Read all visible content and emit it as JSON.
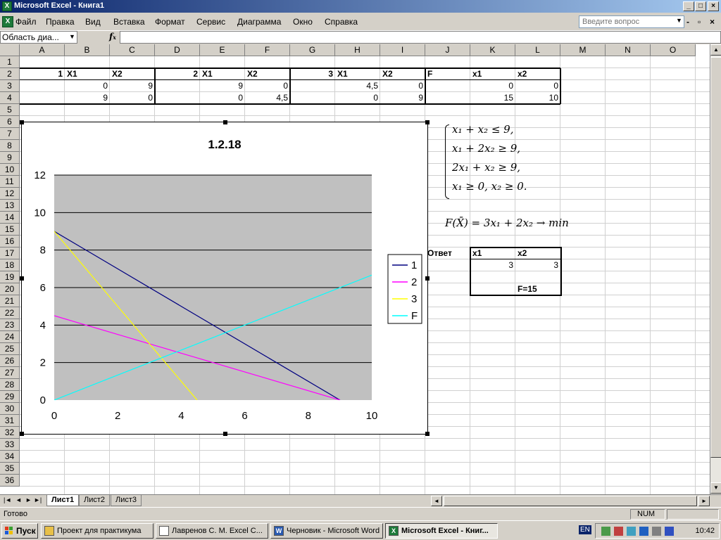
{
  "window": {
    "title": "Microsoft Excel - Книга1",
    "min": "_",
    "max": "□",
    "close": "×",
    "doc_min": "-",
    "doc_restore": "ⓧ",
    "doc_close": "×"
  },
  "menu": {
    "items": [
      "Файл",
      "Правка",
      "Вид",
      "Вставка",
      "Формат",
      "Сервис",
      "Диаграмма",
      "Окно",
      "Справка"
    ],
    "help_placeholder": "Введите вопрос"
  },
  "formula": {
    "namebox": "Область диа...",
    "fx": "fx"
  },
  "columns": [
    "A",
    "B",
    "C",
    "D",
    "E",
    "F",
    "G",
    "H",
    "I",
    "J",
    "K",
    "L",
    "M",
    "N",
    "O"
  ],
  "rows": [
    "1",
    "2",
    "3",
    "4",
    "5",
    "6",
    "7",
    "8",
    "9",
    "10",
    "11",
    "12",
    "13",
    "14",
    "15",
    "16",
    "17",
    "18",
    "19",
    "20",
    "21",
    "22",
    "23",
    "24",
    "25",
    "26",
    "27",
    "28",
    "29",
    "30",
    "31",
    "32",
    "33",
    "34",
    "35",
    "36"
  ],
  "cells": {
    "A2": "1",
    "B2": "X1",
    "C2": "X2",
    "D2": "2",
    "E2": "X1",
    "F2": "X2",
    "G2": "3",
    "H2": "X1",
    "I2": "X2",
    "J2": "F",
    "K2": "x1",
    "L2": "x2",
    "B3": "0",
    "C3": "9",
    "E3": "9",
    "F3": "0",
    "H3": "4,5",
    "I3": "0",
    "K3": "0",
    "L3": "0",
    "B4": "9",
    "C4": "0",
    "E4": "0",
    "F4": "4,5",
    "H4": "0",
    "I4": "9",
    "K4": "15",
    "L4": "10"
  },
  "answer": {
    "label": "Ответ",
    "h1": "x1",
    "h2": "x2",
    "v1": "3",
    "v2": "3",
    "f": "F=15"
  },
  "math": {
    "line1": "x₁ + x₂ ≤ 9,",
    "line2": "x₁ + 2x₂ ≥ 9,",
    "line3": "2x₁ + x₂ ≥ 9,",
    "line4": "x₁ ≥ 0, x₂ ≥ 0.",
    "objective": "F(X̄) = 3x₁ + 2x₂ → min"
  },
  "chart_data": {
    "type": "line",
    "title": "1.2.18",
    "xlim": [
      0,
      10
    ],
    "ylim": [
      0,
      12
    ],
    "x_ticks": [
      "0",
      "2",
      "4",
      "6",
      "8",
      "10"
    ],
    "y_ticks": [
      "0",
      "2",
      "4",
      "6",
      "8",
      "10",
      "12"
    ],
    "plot_bg": "#c0c0c0",
    "grid": true,
    "legend_position": "right",
    "series": [
      {
        "name": "1",
        "color": "#000080",
        "points": [
          [
            0,
            9
          ],
          [
            9,
            0
          ]
        ]
      },
      {
        "name": "2",
        "color": "#ff00ff",
        "points": [
          [
            0,
            4.5
          ],
          [
            9,
            0
          ]
        ]
      },
      {
        "name": "3",
        "color": "#ffff00",
        "points": [
          [
            0,
            9
          ],
          [
            4.5,
            0
          ]
        ]
      },
      {
        "name": "F",
        "color": "#00ffff",
        "points": [
          [
            0,
            0
          ],
          [
            15,
            10
          ]
        ]
      }
    ]
  },
  "sheets": {
    "tabs": [
      "Лист1",
      "Лист2",
      "Лист3"
    ],
    "active": 0
  },
  "status": {
    "ready": "Готово",
    "num": "NUM"
  },
  "taskbar": {
    "start": "Пуск",
    "buttons": [
      {
        "label": "Проект для практикума",
        "icon": "folder-icon"
      },
      {
        "label": "Лавренов С. М. Excel С...",
        "icon": "document-icon"
      },
      {
        "label": "Черновик - Microsoft Word",
        "icon": "word-icon"
      },
      {
        "label": "Microsoft Excel - Книг...",
        "icon": "excel-icon"
      }
    ],
    "lang": "EN",
    "clock": "10:42"
  }
}
